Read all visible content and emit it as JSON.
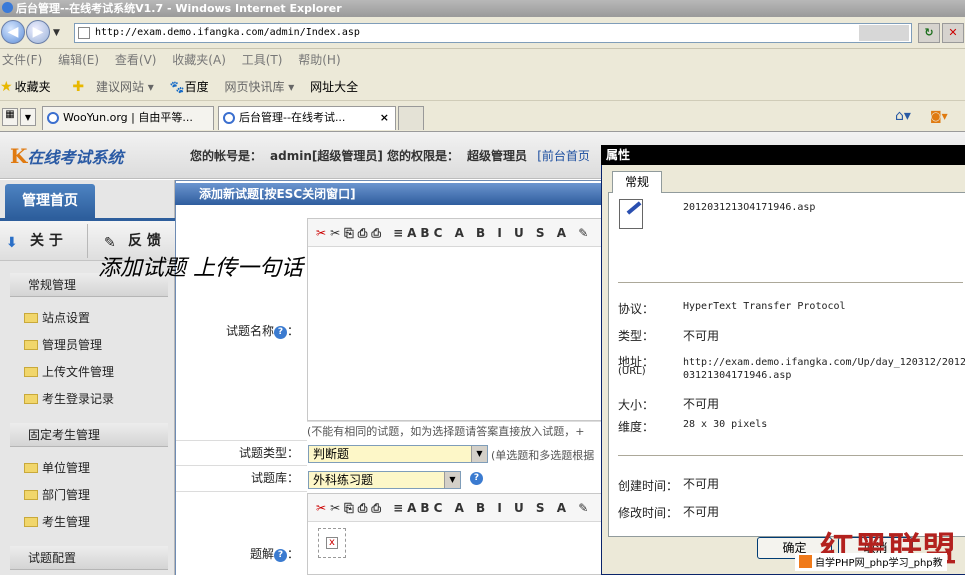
{
  "window": {
    "title": "后台管理--在线考试系统V1.7 - Windows Internet Explorer"
  },
  "address": {
    "url": "http://exam.demo.ifangka.com/admin/Index.asp"
  },
  "menu": [
    "文件(F)",
    "编辑(E)",
    "查看(V)",
    "收藏夹(A)",
    "工具(T)",
    "帮助(H)"
  ],
  "favbar": {
    "favorites": "收藏夹",
    "links": [
      "建议网站 ▾",
      "百度",
      "网页快讯库 ▾",
      "网址大全"
    ]
  },
  "tabs": [
    {
      "label": "WooYun.org | 自由平等..."
    },
    {
      "label": "后台管理--在线考试...",
      "close": "×"
    }
  ],
  "app": {
    "logo_mark": "K",
    "logo_text": "在线考试系统",
    "account_label": "您的帐号是：",
    "account_value": "admin[超级管理员]",
    "perm_label": "您的权限是：",
    "perm_value": "超级管理员",
    "home_link": "[前台首页"
  },
  "sidebar": {
    "nav_tab": "管理首页",
    "about": "关 于",
    "feedback": "反 馈",
    "groups": [
      {
        "title": "常规管理",
        "items": [
          "站点设置",
          "管理员管理",
          "上传文件管理",
          "考生登录记录"
        ]
      },
      {
        "title": "固定考生管理",
        "items": [
          "单位管理",
          "部门管理",
          "考生管理"
        ]
      },
      {
        "title": "试题配置",
        "items": []
      }
    ]
  },
  "annotation": "添加试题 上传一句话",
  "form": {
    "title": "添加新试题[按ESC关闭窗口]",
    "toolbar": "✂⎘⎙⎙ ≡ABC A B I U S A ✎",
    "name_label": "试题名称",
    "name_note": "(不能有相同的试题，如为选择题请答案直接放入试题，+",
    "type_label": "试题类型：",
    "type_value": "判断题",
    "type_note": "(单选题和多选题根据",
    "bank_label": "试题库：",
    "bank_value": "外科练习题",
    "answer_label": "题解",
    "colon": "："
  },
  "props": {
    "title": "属性",
    "tab": "常规",
    "filename": "2012031213O4171946.asp",
    "rows": [
      {
        "key": "协议：",
        "value": "HyperText Transfer Protocol"
      },
      {
        "key": "类型：",
        "value": "不可用"
      },
      {
        "key": "地址：",
        "key2": "(URL)",
        "value": "http://exam.demo.ifangka.com/Up/day_120312/2012",
        "value2": "03121304171946.asp"
      },
      {
        "key": "大小：",
        "value": "不可用"
      },
      {
        "key": "维度：",
        "value": "28  x  30  pixels"
      },
      {
        "key": "创建时间：",
        "value": "不可用"
      },
      {
        "key": "修改时间：",
        "value": "不可用"
      }
    ],
    "ok": "确定",
    "cancel": "取消"
  },
  "watermark": {
    "big": "红黑联盟",
    "small": "自学PHP网_php学习_php教"
  }
}
